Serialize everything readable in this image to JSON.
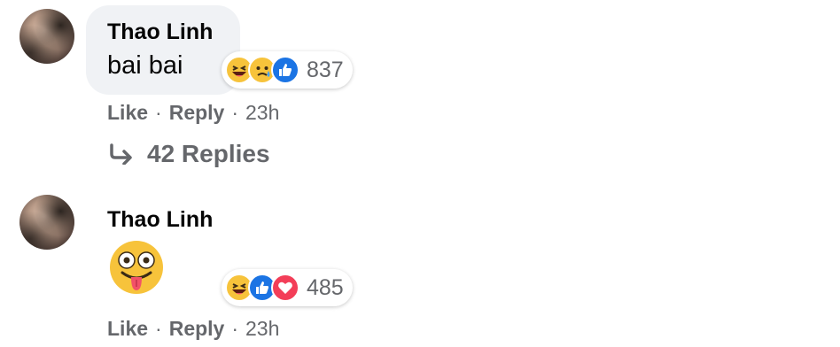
{
  "comments": [
    {
      "author": "Thao Linh",
      "text": "bai bai",
      "reactions": [
        "haha-icon",
        "sad-icon",
        "like-icon"
      ],
      "reaction_count": "837",
      "actions": {
        "like": "Like",
        "reply": "Reply",
        "time": "23h",
        "sep": "·"
      }
    },
    {
      "author": "Thao Linh",
      "emoji": "zany-face-icon",
      "reactions": [
        "haha-icon",
        "like-icon",
        "love-icon"
      ],
      "reaction_count": "485",
      "actions": {
        "like": "Like",
        "reply": "Reply",
        "time": "23h",
        "sep": "·"
      }
    }
  ],
  "replies_link": "42 Replies",
  "colors": {
    "text_primary": "#050505",
    "text_secondary": "#65676b",
    "bubble": "#f0f2f5",
    "like": "#1b74e4",
    "love": "#f33e58",
    "haha": "#f7c33b"
  }
}
